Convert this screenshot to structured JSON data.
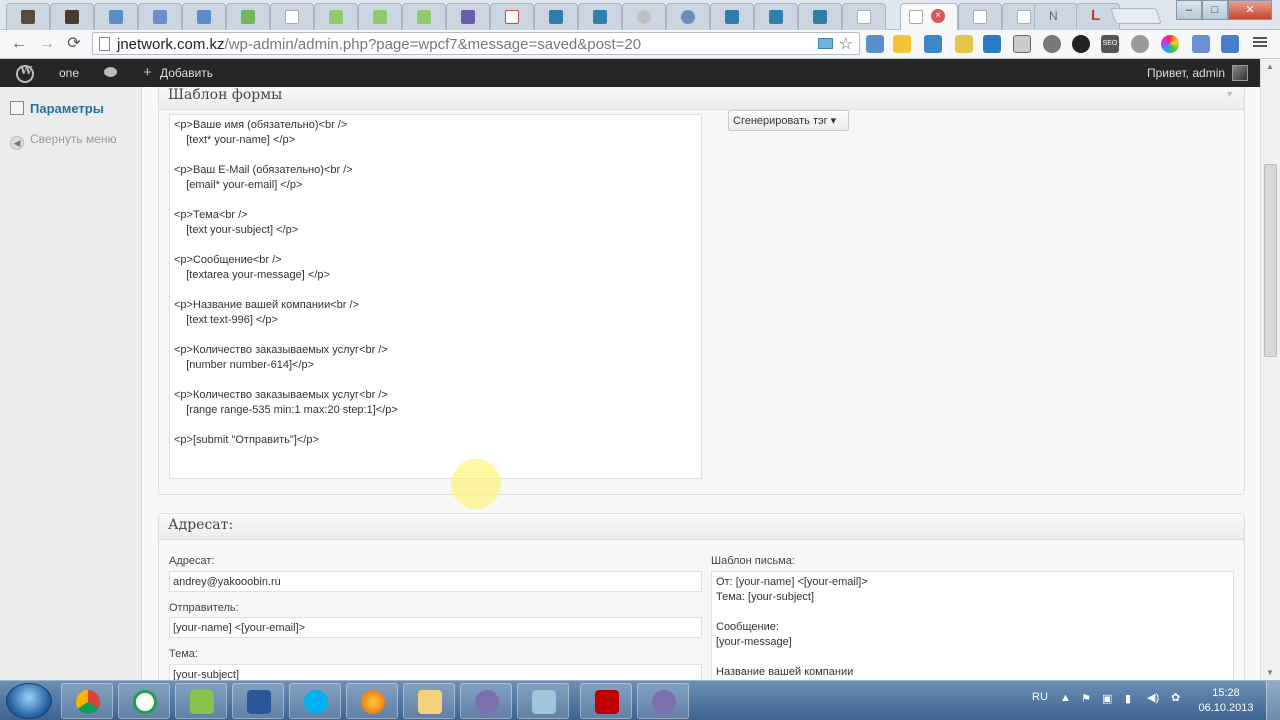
{
  "browser": {
    "url_host": "jnetwork.com.kz",
    "url_path": "/wp-admin/admin.php?page=wpcf7&message=saved&post=20",
    "tab_letters": [
      "N",
      "L"
    ]
  },
  "adminbar": {
    "site_name": "one",
    "add_new": "Добавить",
    "greeting": "Привет, admin"
  },
  "sidebar": {
    "settings": "Параметры",
    "collapse": "Свернуть меню"
  },
  "form_box": {
    "title": "Шаблон формы",
    "generate_tag": "Сгенерировать тэг ▾",
    "template": "<p>Ваше имя (обязательно)<br />\n    [text* your-name] </p>\n\n<p>Ваш E-Mail (обязательно)<br />\n    [email* your-email] </p>\n\n<p>Тема<br />\n    [text your-subject] </p>\n\n<p>Сообщение<br />\n    [textarea your-message] </p>\n\n<p>Название вашей компании<br />\n    [text text-996] </p>\n\n<p>Количество заказываемых услуг<br />\n    [number number-614]</p>\n\n<p>Количество заказываемых услуг<br />\n    [range range-535 min:1 max:20 step:1]</p>\n\n<p>[submit \"Отправить\"]</p>"
  },
  "mail_box": {
    "title": "Адресат:",
    "to_label": "Адресат:",
    "to_value": "andrey@yakooobin.ru",
    "from_label": "Отправитель:",
    "from_value": "[your-name] <[your-email]>",
    "subject_label": "Тема:",
    "subject_value": "[your-subject]",
    "body_label": "Шаблон письма:",
    "body_value": "От: [your-name] <[your-email]>\nТема: [your-subject]\n\nСообщение:\n[your-message]\n\nНазвание вашей компании"
  },
  "taskbar": {
    "lang": "RU",
    "time": "15:28",
    "date": "06.10.2013"
  }
}
